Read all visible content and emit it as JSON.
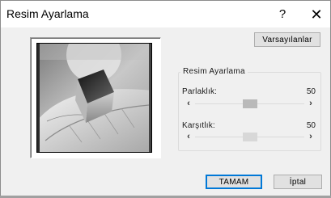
{
  "window": {
    "title": "Resim Ayarlama",
    "help_label": "?",
    "close_label": "✕"
  },
  "buttons": {
    "defaults": "Varsayılanlar",
    "ok": "TAMAM",
    "cancel": "İptal"
  },
  "group": {
    "title": "Resim Ayarlama",
    "brightness": {
      "label": "Parlaklık:",
      "value": "50",
      "level": 0.5
    },
    "contrast": {
      "label": "Karşıtlık:",
      "value": "50",
      "level": 0.5
    }
  },
  "icons": {
    "scroll_left": "‹",
    "scroll_right": "›"
  },
  "colors": {
    "dialog_bg": "#f0f0f0",
    "accent": "#0078d7"
  }
}
